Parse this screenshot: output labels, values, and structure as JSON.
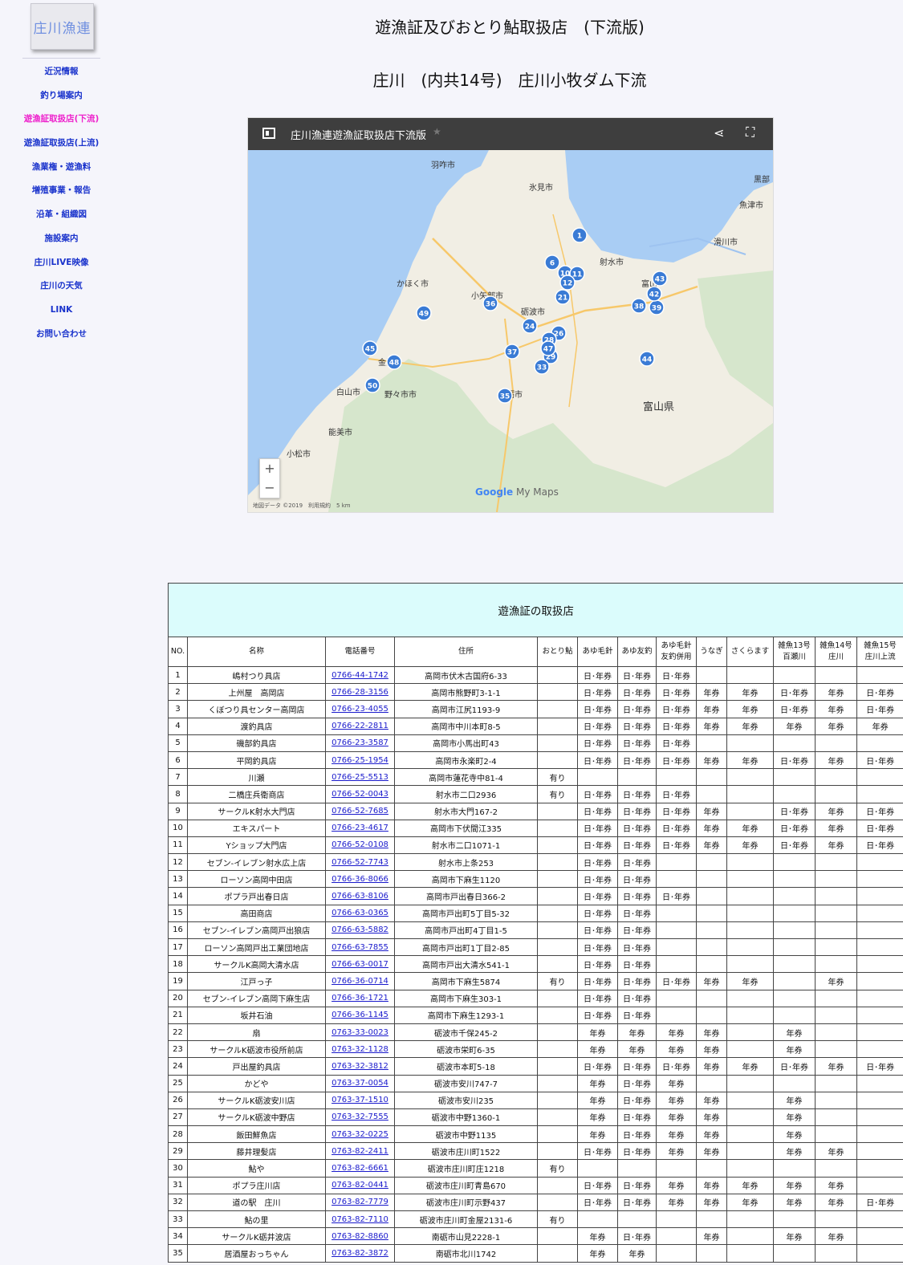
{
  "sidebar": {
    "logo_text": "庄川漁連",
    "items": [
      {
        "label": "近況情報",
        "active": false
      },
      {
        "label": "釣り場案内",
        "active": false
      },
      {
        "label": "遊漁証取扱店(下流)",
        "active": true
      },
      {
        "label": "遊漁証取扱店(上流)",
        "active": false
      },
      {
        "label": "漁業権・遊漁料",
        "active": false
      },
      {
        "label": "増殖事業・報告",
        "active": false
      },
      {
        "label": "沿革・組織図",
        "active": false
      },
      {
        "label": "施設案内",
        "active": false
      },
      {
        "label": "庄川LIVE映像",
        "active": false
      },
      {
        "label": "庄川の天気",
        "active": false
      },
      {
        "label": "LINK",
        "active": false
      },
      {
        "label": "お問い合わせ",
        "active": false
      }
    ]
  },
  "page": {
    "title": "遊漁証及びおとり鮎取扱店　(下流版)",
    "subtitle": "庄川　(内共14号)　庄川小牧ダム下流"
  },
  "map": {
    "title": "庄川漁連遊漁証取扱店下流版",
    "google_label": "Google",
    "mymaps_label": "My Maps",
    "attribution": "地図データ ©2019　利用規約　5 km",
    "places": [
      {
        "name": "羽咋市"
      },
      {
        "name": "氷見市"
      },
      {
        "name": "黒部"
      },
      {
        "name": "魚津市"
      },
      {
        "name": "滑川市"
      },
      {
        "name": "かほく市"
      },
      {
        "name": "小矢部市"
      },
      {
        "name": "砺波市"
      },
      {
        "name": "富山"
      },
      {
        "name": "金沢"
      },
      {
        "name": "白山市"
      },
      {
        "name": "野々市市"
      },
      {
        "name": "南砺市"
      },
      {
        "name": "富山県"
      },
      {
        "name": "能美市"
      },
      {
        "name": "小松市"
      },
      {
        "name": "射水市"
      }
    ],
    "markers": [
      "1",
      "6",
      "10",
      "11",
      "12",
      "21",
      "36",
      "49",
      "24",
      "26",
      "37",
      "28",
      "29",
      "33",
      "35",
      "38",
      "39",
      "42",
      "43",
      "44",
      "45",
      "48",
      "50",
      "47"
    ]
  },
  "table": {
    "caption": "遊漁証の取扱店",
    "headers": [
      "NO.",
      "名称",
      "電話番号",
      "住所",
      "おとり鮎",
      "あゆ毛針",
      "あゆ友釣",
      "あゆ毛針\n友釣併用",
      "うなぎ",
      "さくらます",
      "雑魚13号\n百瀬川",
      "雑魚14号\n庄川",
      "雑魚15号\n庄川上流"
    ],
    "rows": [
      [
        "1",
        "嶋村つり具店",
        "0766-44-1742",
        "高岡市伏木古国府6-33",
        "",
        "日･年券",
        "日･年券",
        "日･年券",
        "",
        "",
        "",
        "",
        ""
      ],
      [
        "2",
        "上州屋　高岡店",
        "0766-28-3156",
        "高岡市熊野町3-1-1",
        "",
        "日･年券",
        "日･年券",
        "日･年券",
        "年券",
        "年券",
        "日･年券",
        "年券",
        "日･年券"
      ],
      [
        "3",
        "くぼつり具センター高岡店",
        "0766-23-4055",
        "高岡市江尻1193-9",
        "",
        "日･年券",
        "日･年券",
        "日･年券",
        "年券",
        "年券",
        "日･年券",
        "年券",
        "日･年券"
      ],
      [
        "4",
        "渡釣具店",
        "0766-22-2811",
        "高岡市中川本町8-5",
        "",
        "日･年券",
        "日･年券",
        "日･年券",
        "年券",
        "年券",
        "年券",
        "年券",
        "年券"
      ],
      [
        "5",
        "磯部釣具店",
        "0766-23-3587",
        "高岡市小馬出町43",
        "",
        "日･年券",
        "日･年券",
        "日･年券",
        "",
        "",
        "",
        "",
        ""
      ],
      [
        "6",
        "平岡釣具店",
        "0766-25-1954",
        "高岡市永楽町2-4",
        "",
        "日･年券",
        "日･年券",
        "日･年券",
        "年券",
        "年券",
        "日･年券",
        "年券",
        "日･年券"
      ],
      [
        "7",
        "川瀬",
        "0766-25-5513",
        "高岡市蓮花寺中81-4",
        "有り",
        "",
        "",
        "",
        "",
        "",
        "",
        "",
        ""
      ],
      [
        "8",
        "二橋庄兵衛商店",
        "0766-52-0043",
        "射水市二口2936",
        "有り",
        "日･年券",
        "日･年券",
        "日･年券",
        "",
        "",
        "",
        "",
        ""
      ],
      [
        "9",
        "サークルK射水大門店",
        "0766-52-7685",
        "射水市大門167-2",
        "",
        "日･年券",
        "日･年券",
        "日･年券",
        "年券",
        "",
        "日･年券",
        "年券",
        "日･年券"
      ],
      [
        "10",
        "エキスパート",
        "0766-23-4617",
        "高岡市下伏間江335",
        "",
        "日･年券",
        "日･年券",
        "日･年券",
        "年券",
        "年券",
        "日･年券",
        "年券",
        "日･年券"
      ],
      [
        "11",
        "Yショップ大門店",
        "0766-52-0108",
        "射水市二口1071-1",
        "",
        "日･年券",
        "日･年券",
        "日･年券",
        "年券",
        "年券",
        "日･年券",
        "年券",
        "日･年券"
      ],
      [
        "12",
        "セブン-イレブン射水広上店",
        "0766-52-7743",
        "射水市上条253",
        "",
        "日･年券",
        "日･年券",
        "",
        "",
        "",
        "",
        "",
        ""
      ],
      [
        "13",
        "ローソン高岡中田店",
        "0766-36-8066",
        "高岡市下麻生1120",
        "",
        "日･年券",
        "日･年券",
        "",
        "",
        "",
        "",
        "",
        ""
      ],
      [
        "14",
        "ポプラ戸出春日店",
        "0766-63-8106",
        "高岡市戸出春日366-2",
        "",
        "日･年券",
        "日･年券",
        "日･年券",
        "",
        "",
        "",
        "",
        ""
      ],
      [
        "15",
        "高田商店",
        "0766-63-0365",
        "高岡市戸出町5丁目5-32",
        "",
        "日･年券",
        "日･年券",
        "",
        "",
        "",
        "",
        "",
        ""
      ],
      [
        "16",
        "セブン-イレブン高岡戸出狼店",
        "0766-63-5882",
        "高岡市戸出町4丁目1-5",
        "",
        "日･年券",
        "日･年券",
        "",
        "",
        "",
        "",
        "",
        ""
      ],
      [
        "17",
        "ローソン高岡戸出工業団地店",
        "0766-63-7855",
        "高岡市戸出町1丁目2-85",
        "",
        "日･年券",
        "日･年券",
        "",
        "",
        "",
        "",
        "",
        ""
      ],
      [
        "18",
        "サークルK高岡大清水店",
        "0766-63-0017",
        "高岡市戸出大清水541-1",
        "",
        "日･年券",
        "日･年券",
        "",
        "",
        "",
        "",
        "",
        ""
      ],
      [
        "19",
        "江戸っ子",
        "0766-36-0714",
        "高岡市下麻生5874",
        "有り",
        "日･年券",
        "日･年券",
        "日･年券",
        "年券",
        "年券",
        "",
        "年券",
        ""
      ],
      [
        "20",
        "セブン-イレブン高岡下麻生店",
        "0766-36-1721",
        "高岡市下麻生303-1",
        "",
        "日･年券",
        "日･年券",
        "",
        "",
        "",
        "",
        "",
        ""
      ],
      [
        "21",
        "坂井石油",
        "0766-36-1145",
        "高岡市下麻生1293-1",
        "",
        "日･年券",
        "日･年券",
        "",
        "",
        "",
        "",
        "",
        ""
      ],
      [
        "22",
        "扇",
        "0763-33-0023",
        "砺波市千保245-2",
        "",
        "年券",
        "年券",
        "年券",
        "年券",
        "",
        "年券",
        "",
        ""
      ],
      [
        "23",
        "サークルK砺波市役所前店",
        "0763-32-1128",
        "砺波市栄町6-35",
        "",
        "年券",
        "年券",
        "年券",
        "年券",
        "",
        "年券",
        "",
        ""
      ],
      [
        "24",
        "戸出屋釣具店",
        "0763-32-3812",
        "砺波市本町5-18",
        "",
        "日･年券",
        "日･年券",
        "日･年券",
        "年券",
        "年券",
        "日･年券",
        "年券",
        "日･年券"
      ],
      [
        "25",
        "かどや",
        "0763-37-0054",
        "砺波市安川747-7",
        "",
        "年券",
        "日･年券",
        "年券",
        "",
        "",
        "",
        "",
        ""
      ],
      [
        "26",
        "サークルK砺波安川店",
        "0763-37-1510",
        "砺波市安川235",
        "",
        "年券",
        "日･年券",
        "年券",
        "年券",
        "",
        "年券",
        "",
        ""
      ],
      [
        "27",
        "サークルK砺波中野店",
        "0763-32-7555",
        "砺波市中野1360-1",
        "",
        "年券",
        "日･年券",
        "年券",
        "年券",
        "",
        "年券",
        "",
        ""
      ],
      [
        "28",
        "飯田鮮魚店",
        "0763-32-0225",
        "砺波市中野1135",
        "",
        "年券",
        "日･年券",
        "年券",
        "年券",
        "",
        "年券",
        "",
        ""
      ],
      [
        "29",
        "藤井理髪店",
        "0763-82-2411",
        "砺波市庄川町1522",
        "",
        "日･年券",
        "日･年券",
        "年券",
        "年券",
        "",
        "年券",
        "年券",
        ""
      ],
      [
        "30",
        "鮎や",
        "0763-82-6661",
        "砺波市庄川町庄1218",
        "有り",
        "",
        "",
        "",
        "",
        "",
        "",
        "",
        ""
      ],
      [
        "31",
        "ポプラ庄川店",
        "0763-82-0441",
        "砺波市庄川町青島670",
        "",
        "日･年券",
        "日･年券",
        "年券",
        "年券",
        "年券",
        "年券",
        "年券",
        ""
      ],
      [
        "32",
        "道の駅　庄川",
        "0763-82-7779",
        "砺波市庄川町示野437",
        "",
        "日･年券",
        "日･年券",
        "年券",
        "年券",
        "年券",
        "年券",
        "年券",
        "日･年券"
      ],
      [
        "33",
        "鮎の里",
        "0763-82-7110",
        "砺波市庄川町金屋2131-6",
        "有り",
        "",
        "",
        "",
        "",
        "",
        "",
        "",
        ""
      ],
      [
        "34",
        "サークルK砺井波店",
        "0763-82-8860",
        "南砺市山見2228-1",
        "",
        "年券",
        "日･年券",
        "",
        "年券",
        "",
        "年券",
        "年券",
        ""
      ],
      [
        "35",
        "居酒屋おっちゃん",
        "0763-82-3872",
        "南砺市北川1742",
        "",
        "年券",
        "年券",
        "",
        "",
        "",
        "",
        "",
        ""
      ]
    ]
  }
}
